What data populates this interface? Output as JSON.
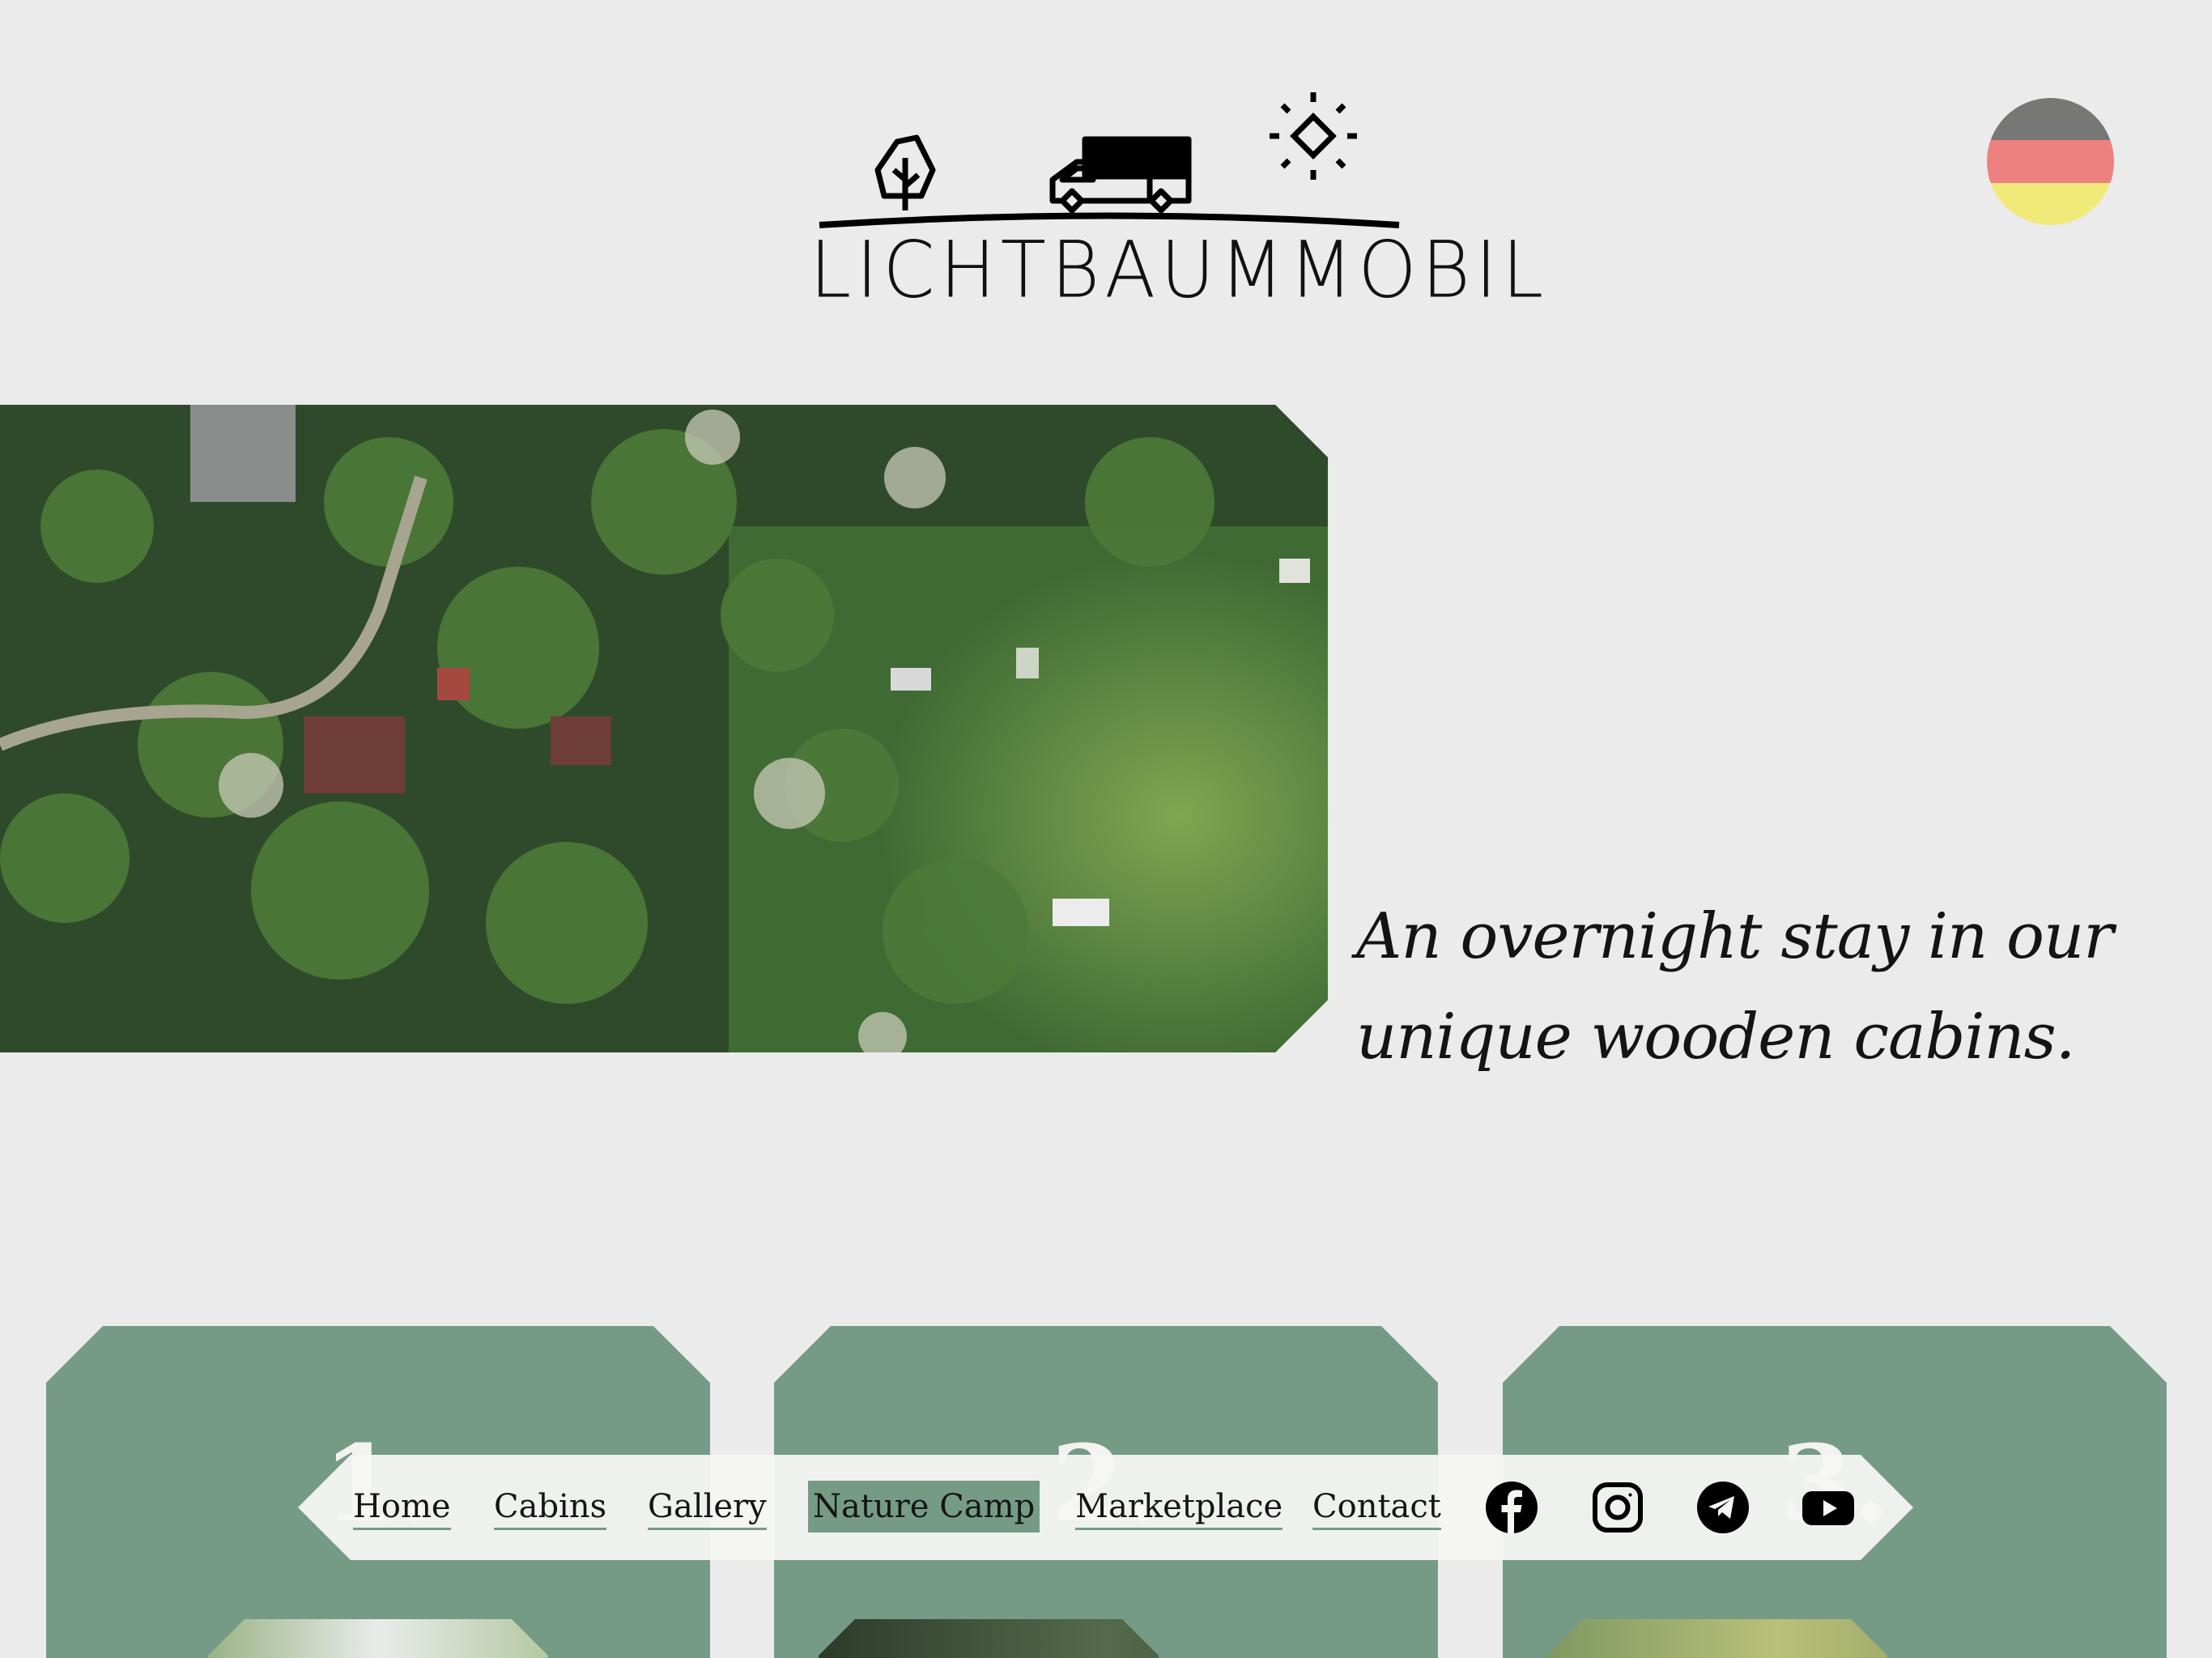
{
  "header": {
    "logo_text": "LICHTBAUMMOBIL",
    "language_flag": "german-flag-icon"
  },
  "hero": {
    "tagline": "An overnight stay in our unique wooden cabins."
  },
  "cards": [
    {
      "number": "1."
    },
    {
      "number": "2."
    },
    {
      "number": "3."
    }
  ],
  "nav": {
    "items": [
      {
        "label": "Home",
        "active": false
      },
      {
        "label": "Cabins",
        "active": false
      },
      {
        "label": "Gallery",
        "active": false
      },
      {
        "label": "Nature Camp",
        "active": true
      },
      {
        "label": "Marketplace",
        "active": false
      },
      {
        "label": "Contact",
        "active": false
      }
    ],
    "social": [
      "facebook-icon",
      "instagram-icon",
      "telegram-icon",
      "youtube-icon"
    ]
  },
  "colors": {
    "background": "#ebebeb",
    "accent_green": "#759b86",
    "flag_black": "#777775",
    "flag_red": "#ef8080",
    "flag_gold": "#f1ea78"
  }
}
